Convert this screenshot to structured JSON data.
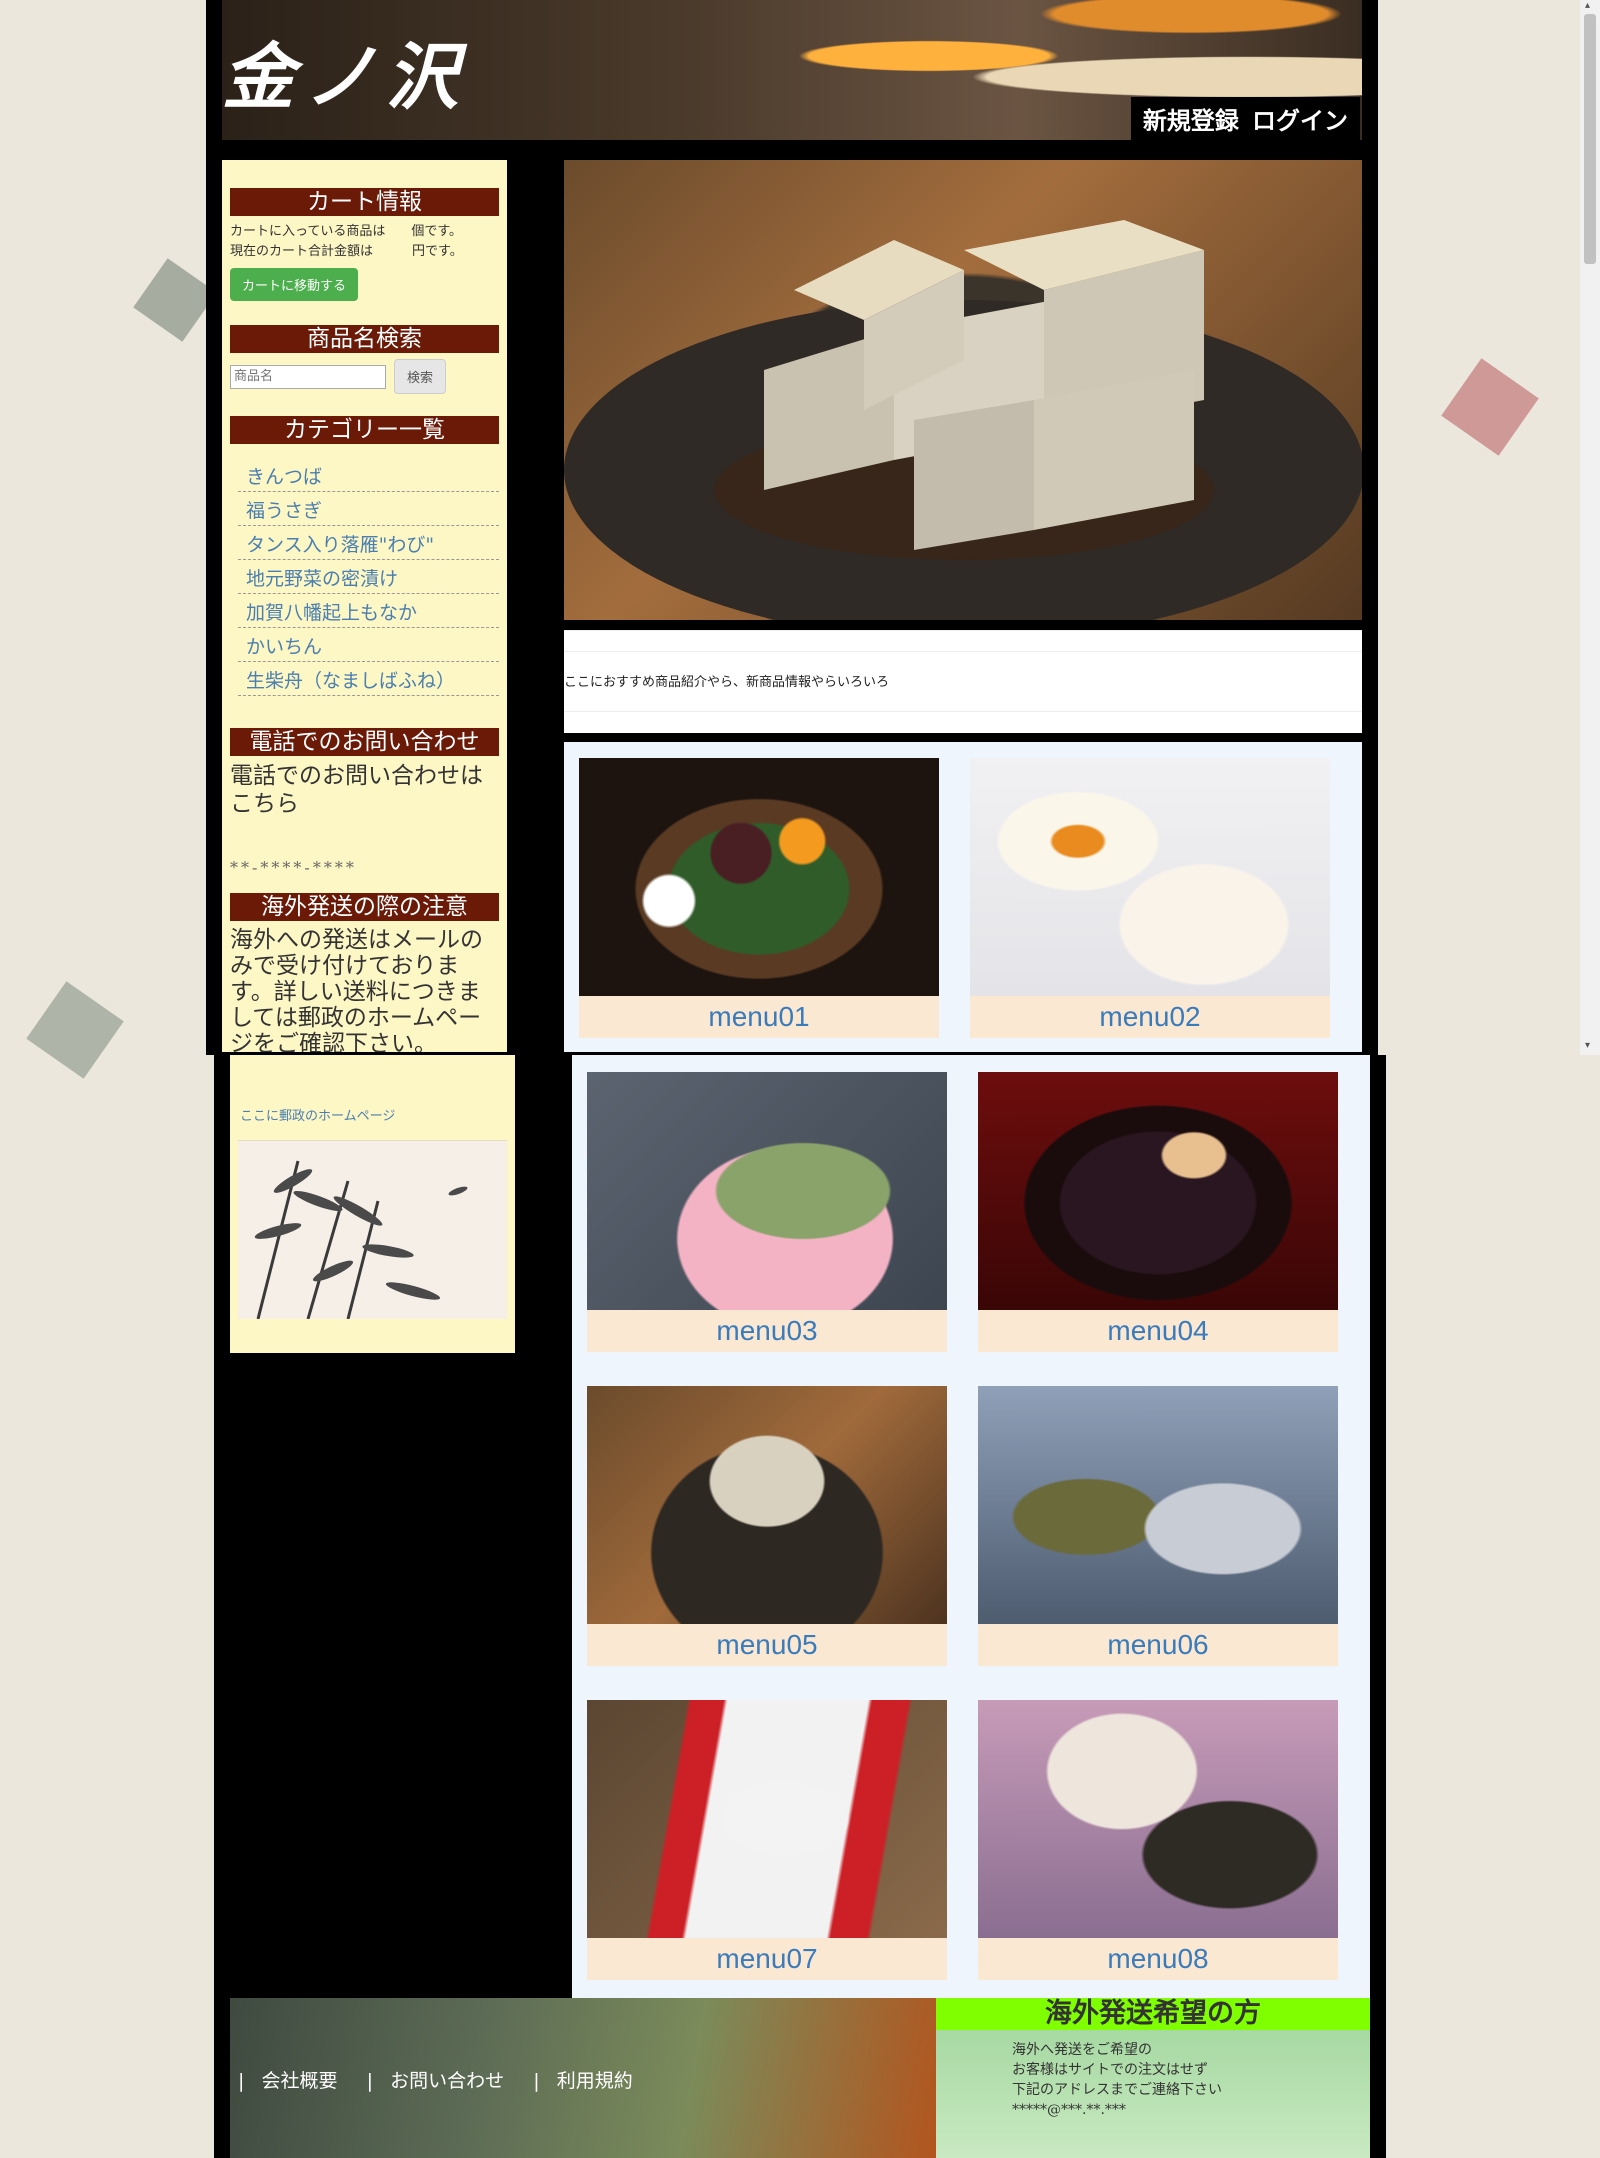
{
  "header": {
    "logo": "金ノ沢",
    "register_label": "新規登録",
    "login_label": "ログイン"
  },
  "sidebar": {
    "cart": {
      "title": "カート情報",
      "line1": "カートに入っている商品は　　個です。",
      "line2": "現在のカート合計金額は　　　円です。",
      "button": "カートに移動する"
    },
    "search": {
      "title": "商品名検索",
      "placeholder": "商品名",
      "button": "検索"
    },
    "categories": {
      "title": "カテゴリー一覧",
      "items": [
        "きんつば",
        "福うさぎ",
        "タンス入り落雁\"わび\"",
        "地元野菜の密漬け",
        "加賀八幡起上もなか",
        "かいちん",
        "生柴舟（なましばふね）"
      ]
    },
    "phone": {
      "title": "電話でのお問い合わせ",
      "text": "電話でのお問い合わせはこちら",
      "number": "**-****-****"
    },
    "overseas": {
      "title": "海外発送の際の注意",
      "text": "海外への発送はメールのみで受け付けております。詳しい送料につきましては郵政のホームページをご確認下さい。",
      "link": "ここに郵政のホームページ"
    }
  },
  "main": {
    "intro_text": "ここにおすすめ商品紹介やら、新商品情報やらいろいろ",
    "menus": [
      "menu01",
      "menu02",
      "menu03",
      "menu04",
      "menu05",
      "menu06",
      "menu07",
      "menu08"
    ]
  },
  "footer": {
    "nav": [
      "会社概要",
      "お問い合わせ",
      "利用規約"
    ],
    "separator": "|",
    "overseas_title": "海外発送希望の方",
    "overseas_line1": "海外へ発送をご希望の",
    "overseas_line2": "お客様はサイトでの注文はせず",
    "overseas_line3": "下記のアドレスまでご連絡下さい",
    "overseas_email": "*****@***.**.***"
  },
  "colors": {
    "sidebar_bg": "#fdf6c5",
    "heading_bg": "#6b1a08",
    "link": "#4a7fb0",
    "menu_label_bg": "#fbe8d3",
    "menu_label_text": "#3a7bbb",
    "cart_button": "#4cae4c",
    "footer_heading_bg": "#7fff00"
  }
}
